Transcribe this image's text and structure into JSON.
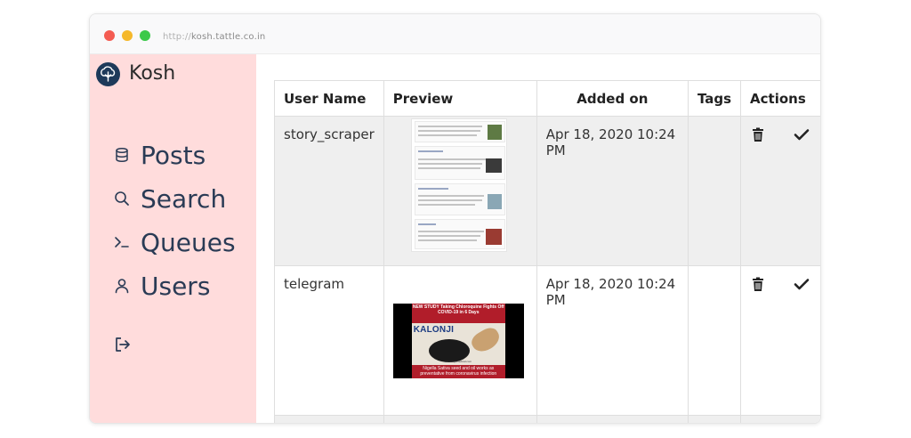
{
  "browser": {
    "url_protocol": "http://",
    "url_host": "kosh.tattle.co.in"
  },
  "sidebar": {
    "brand": "Kosh",
    "items": [
      {
        "label": "Posts",
        "icon": "database-icon"
      },
      {
        "label": "Search",
        "icon": "search-icon"
      },
      {
        "label": "Queues",
        "icon": "terminal-icon"
      },
      {
        "label": "Users",
        "icon": "user-icon"
      }
    ],
    "logout_icon": "logout-icon"
  },
  "table": {
    "headers": {
      "user_name": "User Name",
      "preview": "Preview",
      "added_on": "Added on",
      "tags": "Tags",
      "actions": "Actions"
    },
    "rows": [
      {
        "user_name": "story_scraper",
        "added_on": "Apr 18, 2020 10:24 PM",
        "tags": "",
        "preview_kind": "social-posts-screenshot"
      },
      {
        "user_name": "telegram",
        "added_on": "Apr 18, 2020 10:24 PM",
        "tags": "",
        "preview_kind": "news-image",
        "preview": {
          "headline": "NEW STUDY Taking Chloroquine Fights Off COVID-19 in 6 Days",
          "title": "KALONJI",
          "site": "www.mypmedical.com",
          "caption": "Nigella Sativa seed and oil works as preventative from coronavirus infection"
        }
      }
    ]
  },
  "colors": {
    "sidebar_bg": "#ffdcdc",
    "nav_text": "#2a3b55",
    "row_alt_bg": "#efefef"
  }
}
